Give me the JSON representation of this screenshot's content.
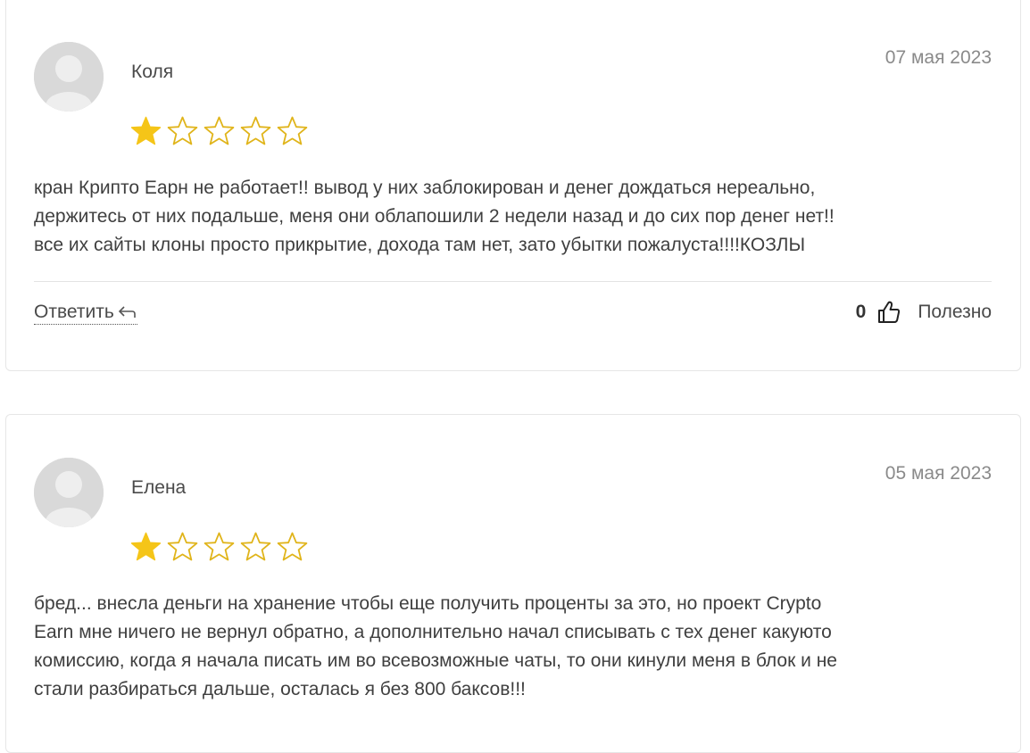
{
  "reviews": [
    {
      "author": "Коля",
      "date": "07 мая 2023",
      "rating": 1,
      "rating_max": 5,
      "text_lines": [
        "кран Крипто Еарн не работает!! вывод у них заблокирован и денег дождаться нереально,",
        "держитесь от них подальше, меня они облапошили 2 недели назад и до сих пор денег нет!!",
        "все их сайты клоны просто прикрытие, дохода там нет, зато убытки пожалуста!!!!КОЗЛЫ"
      ],
      "reply_label": "Ответить",
      "useful_count": "0",
      "useful_label": "Полезно"
    },
    {
      "author": "Елена",
      "date": "05 мая 2023",
      "rating": 1,
      "rating_max": 5,
      "text_lines": [
        "бред... внесла деньги на хранение чтобы еще получить проценты за это, но проект Crypto",
        "Earn мне ничего не вернул обратно, а дополнительно начал списывать с тех денег какуюто",
        "комиссию, когда я начала писать им во всевозможные чаты, то они кинули меня в блок и не",
        "стали разбираться дальше, осталась я без 800 баксов!!!"
      ]
    }
  ],
  "colors": {
    "star_filled": "#f5c518",
    "star_empty_stroke": "#e0b41a",
    "avatar_bg": "#d9d9d9",
    "avatar_fg": "#eeeeee"
  },
  "icons": {
    "avatar": "user-placeholder-icon",
    "reply": "reply-arrow-icon",
    "like": "thumbs-up-icon"
  }
}
